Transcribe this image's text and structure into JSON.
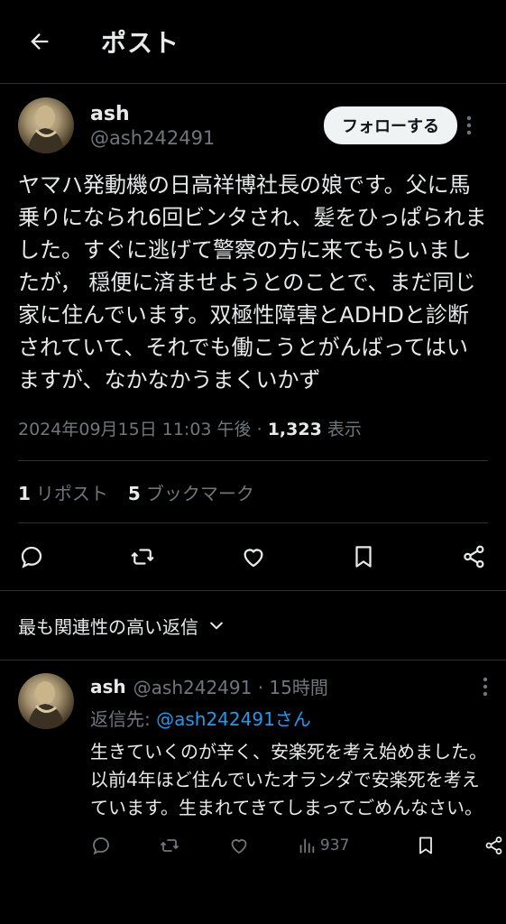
{
  "header": {
    "title": "ポスト"
  },
  "post": {
    "name": "ash",
    "handle": "@ash242491",
    "follow_label": "フォローする",
    "text": "ヤマハ発動機の日高祥博社長の娘です。父に馬乗りになられ6回ビンタされ、髪をひっぱられました。すぐに逃げて警察の方に来てもらいましたが， 穏便に済ませようとのことで、まだ同じ家に住んでいます。双極性障害とADHDと診断されていて、それでも働こうとがんばってはいますが、なかなかうまくいかず",
    "timestamp": "2024年09月15日 11:03 午後",
    "views_count": "1,323",
    "views_label": "表示",
    "reposts_count": "1",
    "reposts_label": "リポスト",
    "bookmarks_count": "5",
    "bookmarks_label": "ブックマーク"
  },
  "replies_section": {
    "label": "最も関連性の高い返信"
  },
  "reply": {
    "name": "ash",
    "handle_time": "@ash242491 · 15時間",
    "replying_prefix": "返信先:",
    "replying_to": "@ash242491さん",
    "text": "生きていくのが辛く、安楽死を考え始めました。以前4年ほど住んでいたオランダで安楽死を考えています。生まれてきてしまってごめんなさい。",
    "views": "937"
  },
  "icons": {
    "back": "arrow-left-icon",
    "more": "more-vertical-icon",
    "reply": "reply-icon",
    "repost": "repost-icon",
    "like": "heart-icon",
    "bookmark": "bookmark-icon",
    "share": "share-icon",
    "views": "views-icon",
    "chevron": "chevron-down-icon"
  },
  "colors": {
    "background": "#000000",
    "text": "#e7e9ea",
    "muted": "#71767b",
    "link": "#1d9bf0",
    "border": "#2f3336"
  }
}
